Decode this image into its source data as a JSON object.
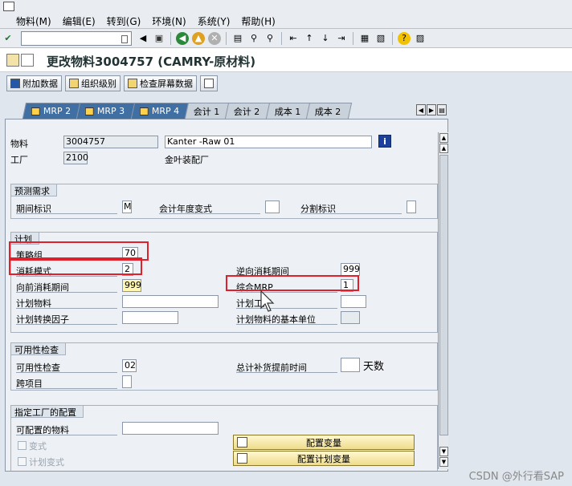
{
  "menu": [
    "物料(M)",
    "编辑(E)",
    "转到(G)",
    "环境(N)",
    "系统(Y)",
    "帮助(H)"
  ],
  "title": "更改物料3004757 (CAMRY-原材料)",
  "app_toolbar": {
    "additional_data": "附加数据",
    "org_levels": "组织级别",
    "check_screen_data": "检查屏幕数据"
  },
  "tabs": [
    "MRP 2",
    "MRP 3",
    "MRP 4",
    "会计 1",
    "会计 2",
    "成本 1",
    "成本 2"
  ],
  "active_tab": "MRP 3",
  "header": {
    "material_label": "物料",
    "material_value": "3004757",
    "material_desc": "Kanter -Raw 01",
    "plant_label": "工厂",
    "plant_value": "2100",
    "plant_name": "金叶装配厂"
  },
  "forecast": {
    "title": "预测需求",
    "period_label": "期间标识",
    "period_value": "M",
    "fiscal_variant_label": "会计年度变式",
    "split_label": "分割标识"
  },
  "planning": {
    "title": "计划",
    "strategy_group_label": "策略组",
    "strategy_group_value": "70",
    "consumption_mode_label": "消耗模式",
    "consumption_mode_value": "2",
    "backward_period_label": "逆向消耗期间",
    "backward_period_value": "999",
    "forward_period_label": "向前消耗期间",
    "forward_period_value": "999",
    "mixed_mrp_label": "综合MRP",
    "mixed_mrp_value": "1",
    "planning_material_label": "计划物料",
    "planning_plant_label": "计划工厂",
    "conversion_factor_label": "计划转换因子",
    "base_unit_label": "计划物料的基本单位"
  },
  "availability": {
    "title": "可用性检查",
    "check_label": "可用性检查",
    "check_value": "02",
    "total_lead_label": "总计补货提前时间",
    "days_label": "天数",
    "cross_project_label": "跨项目"
  },
  "plant_config": {
    "title": "指定工厂的配置",
    "configurable_label": "可配置的物料",
    "variant_label": "变式",
    "planning_variant_label": "计划变式",
    "config_variant_btn": "配置变量",
    "config_planning_variant_btn": "配置计划变量"
  },
  "watermark": "CSDN @外行看SAP",
  "colors": {
    "highlight_red": "#e0202a",
    "tab_active": "#3f6fa3",
    "panel_bg": "#edf1f5"
  }
}
